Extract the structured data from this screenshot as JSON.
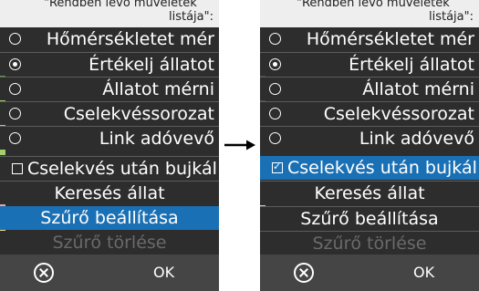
{
  "header": {
    "line1": "\"Rendben lévő műveletek",
    "line2": "listája\":"
  },
  "left_screen": {
    "items": [
      {
        "type": "radio",
        "checked": false,
        "label": "Hőmérsékletet mér"
      },
      {
        "type": "radio",
        "checked": true,
        "label": "Értékelj állatot"
      },
      {
        "type": "radio",
        "checked": false,
        "label": "Állatot mérni"
      },
      {
        "type": "radio",
        "checked": false,
        "label": "Cselekvéssorozat"
      },
      {
        "type": "radio",
        "checked": false,
        "label": "Link adóvevő"
      },
      {
        "type": "checkbox",
        "checked": false,
        "label": "Cselekvés után bujkál"
      },
      {
        "type": "action",
        "label": "Keresés állat"
      },
      {
        "type": "action",
        "selected": true,
        "label": "Szűrő beállítása"
      },
      {
        "type": "action",
        "disabled": true,
        "label": "Szűrő törlése"
      }
    ],
    "footer": {
      "cancel_icon": "cancel-circle-x-icon",
      "ok_label": "OK"
    }
  },
  "right_screen": {
    "items": [
      {
        "type": "radio",
        "checked": false,
        "label": "Hőmérsékletet mér"
      },
      {
        "type": "radio",
        "checked": true,
        "label": "Értékelj állatot"
      },
      {
        "type": "radio",
        "checked": false,
        "label": "Állatot mérni"
      },
      {
        "type": "radio",
        "checked": false,
        "label": "Cselekvéssorozat"
      },
      {
        "type": "radio",
        "checked": false,
        "label": "Link adóvevő"
      },
      {
        "type": "checkbox",
        "checked": true,
        "selected": true,
        "label": "Cselekvés után bujkál"
      },
      {
        "type": "action",
        "label": "Keresés állat"
      },
      {
        "type": "action",
        "label": "Szűrő beállítása"
      },
      {
        "type": "action",
        "disabled": true,
        "label": "Szűrő törlése"
      }
    ],
    "footer": {
      "cancel_icon": "cancel-circle-x-icon",
      "ok_label": "OK"
    }
  },
  "transition_icon": "right-arrow-icon",
  "colors": {
    "panel_bg": "#2d2d2d",
    "selection": "#1a70b5",
    "footer_bg": "#454545",
    "header_bg": "#eeeeee",
    "disabled_text": "#6a6a6a"
  }
}
